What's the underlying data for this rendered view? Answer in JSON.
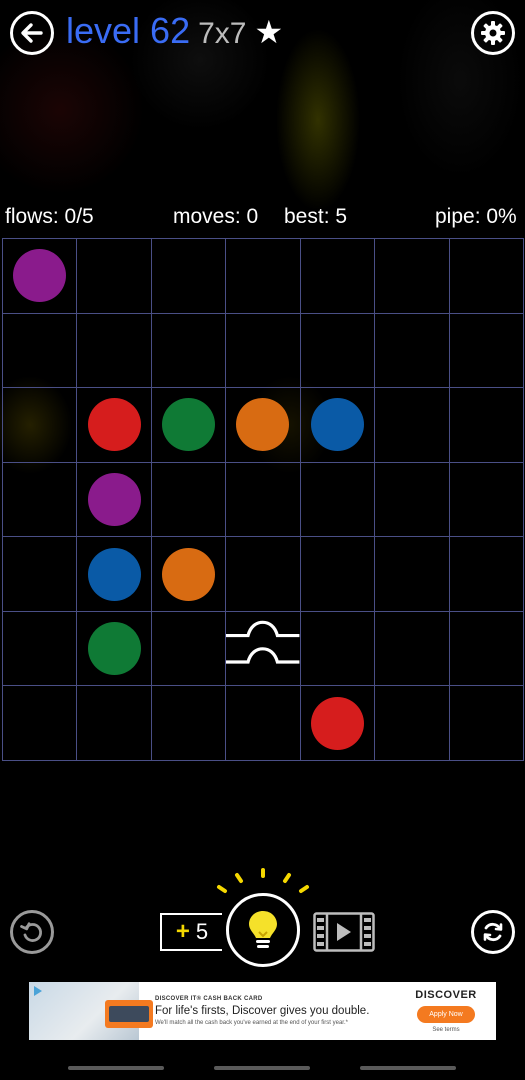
{
  "header": {
    "level_label": "level 62",
    "grid_size": "7x7",
    "star": "★"
  },
  "stats": {
    "flows": "flows: 0/5",
    "moves": "moves: 0",
    "best": "best: 5",
    "pipe": "pipe: 0%"
  },
  "colors": {
    "purple": "#8a1b8c",
    "red": "#d61d1d",
    "green": "#0f7a35",
    "orange": "#d86b12",
    "blue": "#0a5aa6",
    "grid_line": "#4a4f86",
    "title_blue": "#3a6cf4",
    "hint_yellow": "#f5d800"
  },
  "board": {
    "rows": 7,
    "cols": 7,
    "dots": [
      {
        "row": 0,
        "col": 0,
        "color": "purple"
      },
      {
        "row": 2,
        "col": 1,
        "color": "red"
      },
      {
        "row": 2,
        "col": 2,
        "color": "green"
      },
      {
        "row": 2,
        "col": 3,
        "color": "orange"
      },
      {
        "row": 2,
        "col": 4,
        "color": "blue"
      },
      {
        "row": 3,
        "col": 1,
        "color": "purple"
      },
      {
        "row": 4,
        "col": 1,
        "color": "blue"
      },
      {
        "row": 4,
        "col": 2,
        "color": "orange"
      },
      {
        "row": 5,
        "col": 1,
        "color": "green"
      },
      {
        "row": 6,
        "col": 4,
        "color": "red"
      }
    ],
    "bridges": [
      {
        "row": 5,
        "col": 3
      }
    ]
  },
  "controls": {
    "back_icon": "arrow-left-icon",
    "settings_icon": "gear-icon",
    "undo_icon": "undo-icon",
    "restart_icon": "refresh-icon",
    "hint_count": "5",
    "hint_plus": "+",
    "hint_icon": "lightbulb-icon",
    "video_icon": "film-play-icon"
  },
  "ad": {
    "eyebrow": "DISCOVER IT® CASH BACK CARD",
    "headline": "For life's firsts, Discover gives you double.",
    "subline": "We'll match all the cash back you've earned at the end of your first year.*",
    "brand": "DISCOVER",
    "cta": "Apply Now",
    "terms": "See terms"
  }
}
